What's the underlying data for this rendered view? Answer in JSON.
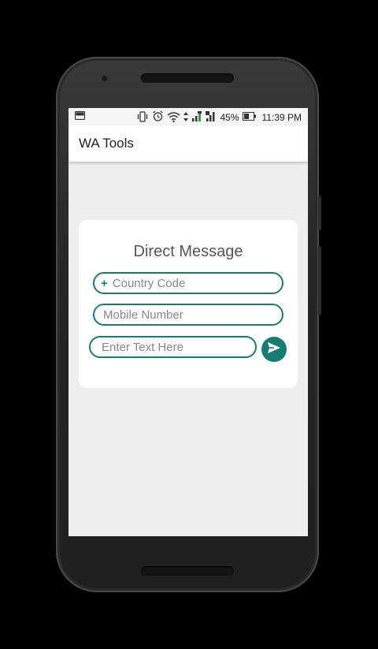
{
  "status_bar": {
    "battery_percent": "45%",
    "time": "11:39 PM",
    "icons": [
      "image-icon",
      "vibrate-icon",
      "alarm-icon",
      "wifi-icon",
      "data-arrows-icon",
      "signal-icon",
      "signal-icon",
      "battery-icon"
    ]
  },
  "app_bar": {
    "title": "WA Tools"
  },
  "direct_message": {
    "title": "Direct Message",
    "country_code": {
      "prefix": "+",
      "placeholder": "Country Code",
      "value": ""
    },
    "mobile_number": {
      "placeholder": "Mobile Number",
      "value": ""
    },
    "message_text": {
      "placeholder": "Enter Text Here",
      "value": ""
    },
    "send_icon": "send-icon"
  },
  "colors": {
    "accent": "#167d72",
    "background": "#eeeeee",
    "card": "#ffffff",
    "phone_frame": "#262626"
  }
}
